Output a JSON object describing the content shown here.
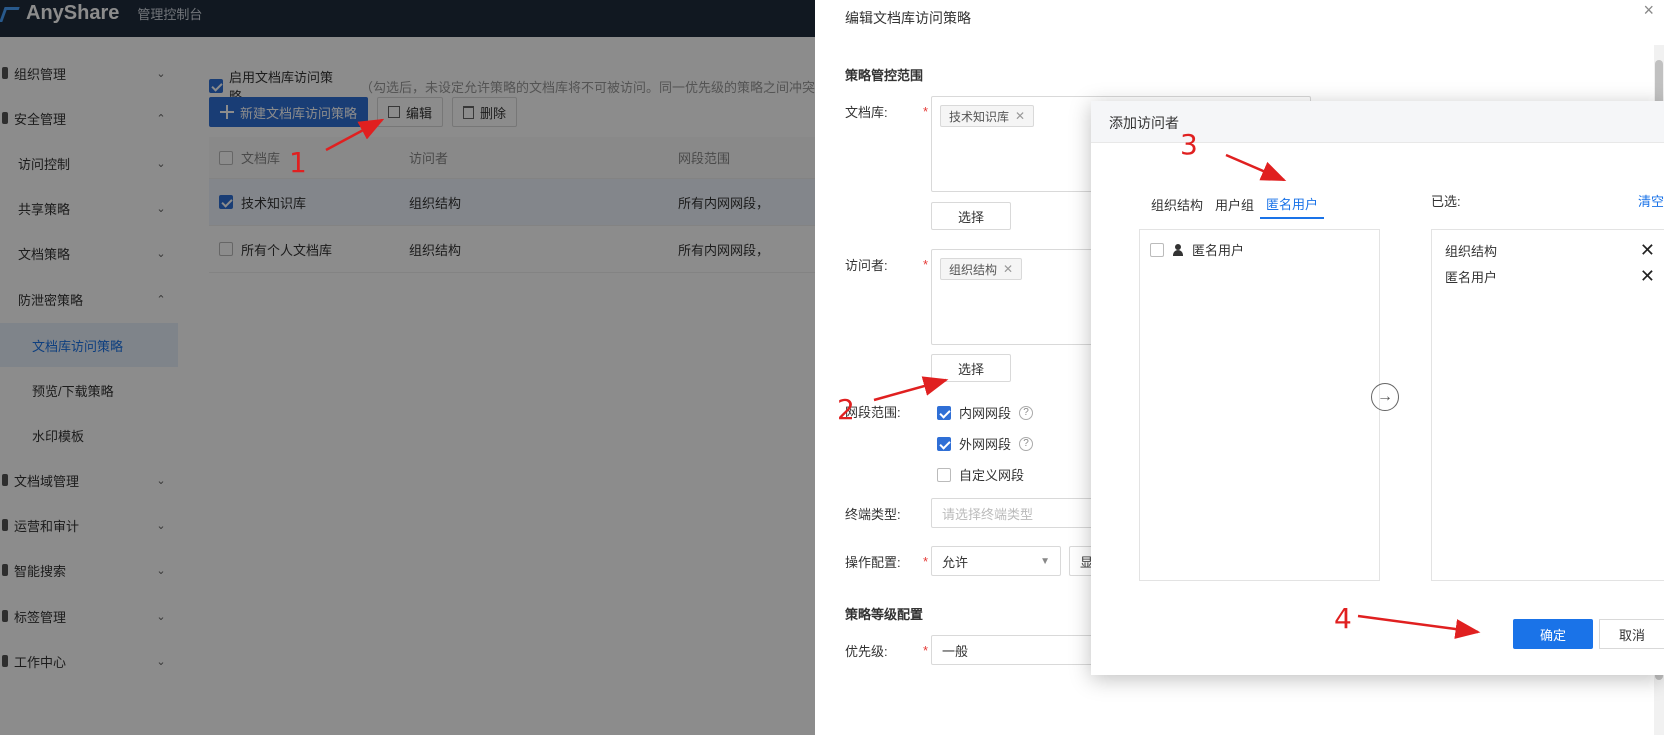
{
  "header": {
    "brand": "AnyShare",
    "console": "管理控制台"
  },
  "sidebar": {
    "items": [
      {
        "label": "组织管理",
        "chevron": "⌄"
      },
      {
        "label": "安全管理",
        "chevron": "⌃"
      },
      {
        "label": "访问控制",
        "chevron": "⌄"
      },
      {
        "label": "共享策略",
        "chevron": "⌄"
      },
      {
        "label": "文档策略",
        "chevron": "⌄"
      },
      {
        "label": "防泄密策略",
        "chevron": "⌃"
      },
      {
        "label": "文档库访问策略"
      },
      {
        "label": "预览/下载策略"
      },
      {
        "label": "水印模板"
      },
      {
        "label": "文档域管理",
        "chevron": "⌄"
      },
      {
        "label": "运营和审计",
        "chevron": "⌄"
      },
      {
        "label": "智能搜索",
        "chevron": "⌄"
      },
      {
        "label": "标签管理",
        "chevron": "⌄"
      },
      {
        "label": "工作中心",
        "chevron": "⌄"
      }
    ]
  },
  "main": {
    "enable_label": "启用文档库访问策略",
    "enable_hint": "（勾选后，未设定允许策略的文档库将不可被访问。同一优先级的策略之间冲突",
    "toolbar": {
      "new_label": "新建文档库访问策略",
      "edit_label": "编辑",
      "delete_label": "删除"
    },
    "table": {
      "headers": [
        "文档库",
        "访问者",
        "网段范围"
      ],
      "rows": [
        {
          "library": "技术知识库",
          "visitor": "组织结构",
          "network": "所有内网网段，"
        },
        {
          "library": "所有个人文档库",
          "visitor": "组织结构",
          "network": "所有内网网段，"
        }
      ]
    }
  },
  "drawer": {
    "title": "编辑文档库访问策略",
    "close": "×",
    "scope_section": "策略管控范围",
    "library_label": "文档库:",
    "library_tag": "技术知识库",
    "select_label": "选择",
    "visitor_label": "访问者:",
    "visitor_tag": "组织结构",
    "network_label": "网段范围:",
    "network_options": [
      {
        "label": "内网网段",
        "checked": true,
        "help": "?"
      },
      {
        "label": "外网网段",
        "checked": true,
        "help": "?"
      },
      {
        "label": "自定义网段",
        "checked": false
      }
    ],
    "terminal_label": "终端类型:",
    "terminal_placeholder": "请选择终端类型",
    "operation_label": "操作配置:",
    "operation_value": "允许",
    "operation_extra": "显",
    "level_section": "策略等级配置",
    "priority_label": "优先级:",
    "priority_value": "一般",
    "required_mark": "*"
  },
  "modal": {
    "title": "添加访问者",
    "tabs": [
      "组织结构",
      "用户组",
      "匿名用户"
    ],
    "active_tab": "匿名用户",
    "left_items": [
      {
        "label": "匿名用户"
      }
    ],
    "selected_label": "已选:",
    "clear_label": "清空",
    "selected_items": [
      {
        "label": "组织结构"
      },
      {
        "label": "匿名用户"
      }
    ],
    "remove_glyph": "✕",
    "transfer_glyph": "→",
    "ok_label": "确定",
    "cancel_label": "取消"
  },
  "annotations": {
    "step1": "1",
    "step2": "2",
    "step3": "3",
    "step4": "4",
    "color": "#e02020"
  },
  "colors": {
    "accent": "#1a73e8",
    "topbar": "#1f2d3d",
    "primary_button": "#2f6fd6"
  }
}
